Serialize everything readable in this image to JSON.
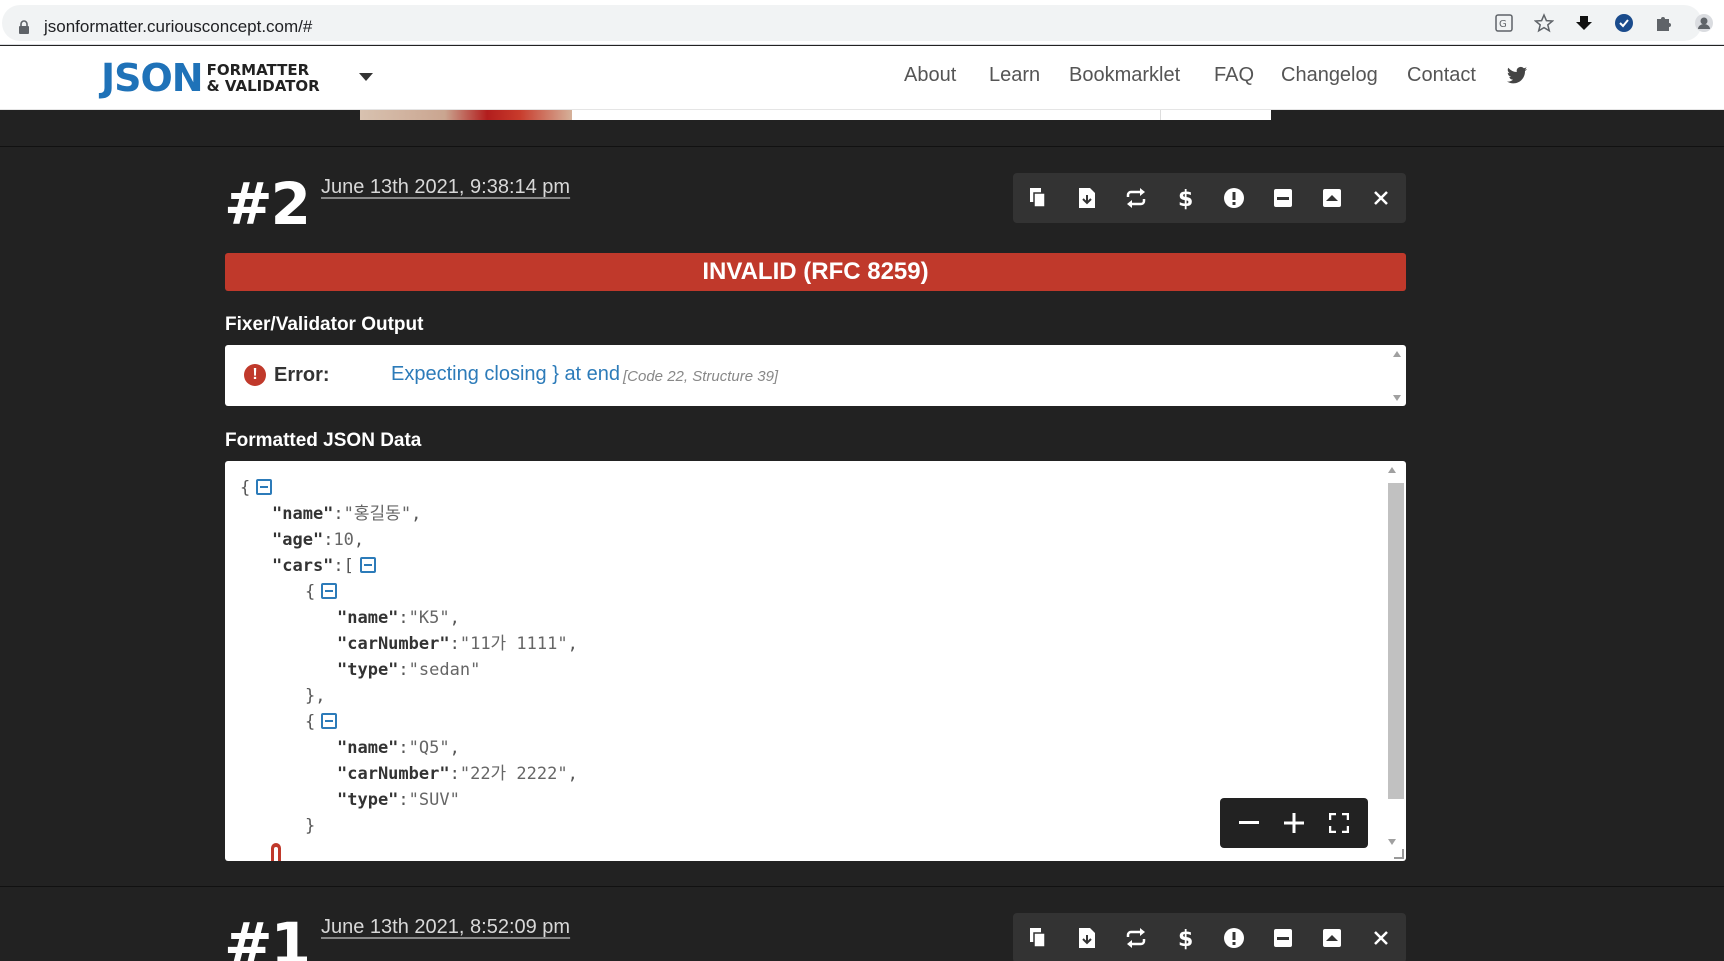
{
  "browser": {
    "url": "jsonformatter.curiousconcept.com/#",
    "extension_icons": [
      "translate-icon",
      "star-icon",
      "download-icon",
      "check-badge-icon",
      "puzzle-icon",
      "profile-icon"
    ]
  },
  "header": {
    "logo_main": "JSON",
    "logo_line1": "FORMATTER",
    "logo_line2": "& VALIDATOR",
    "nav": [
      "About",
      "Learn",
      "Bookmarklet",
      "FAQ",
      "Changelog",
      "Contact"
    ]
  },
  "entries": [
    {
      "number": "#2",
      "date": "June 13th 2021, 9:38:14 pm",
      "status": "INVALID (RFC 8259)",
      "validator_title": "Fixer/Validator Output",
      "error_label": "Error:",
      "error_message": "Expecting closing } at end",
      "error_code": "[Code 22, Structure 39]",
      "json_title": "Formatted JSON Data"
    },
    {
      "number": "#1",
      "date": "June 13th 2021, 8:52:09 pm"
    }
  ],
  "toolbar_icons": [
    "copy-icon",
    "download-icon",
    "repeat-icon",
    "dollar-icon",
    "exclamation-icon",
    "collapse-icon",
    "expand-icon",
    "close-icon"
  ],
  "json_data": {
    "line1_open": "{",
    "k_name": "\"name\"",
    "v_name": "\"홍길동\"",
    "k_age": "\"age\"",
    "v_age": "10",
    "k_cars": "\"cars\"",
    "bracket_open": "[",
    "obj_open": "{",
    "obj_close_comma": "},",
    "obj_close": "}",
    "car1": {
      "k_name": "\"name\"",
      "v_name": "\"K5\"",
      "k_num": "\"carNumber\"",
      "v_num": "\"11가 1111\"",
      "k_type": "\"type\"",
      "v_type": "\"sedan\""
    },
    "car2": {
      "k_name": "\"name\"",
      "v_name": "\"Q5\"",
      "k_num": "\"carNumber\"",
      "v_num": "\"22가 2222\"",
      "k_type": "\"type\"",
      "v_type": "\"SUV\""
    },
    "colon": ":",
    "comma": ","
  },
  "colors": {
    "background": "#222222",
    "invalid_banner": "#c0392b",
    "logo_blue": "#1f72b8",
    "link_blue": "#2c7bb9"
  }
}
